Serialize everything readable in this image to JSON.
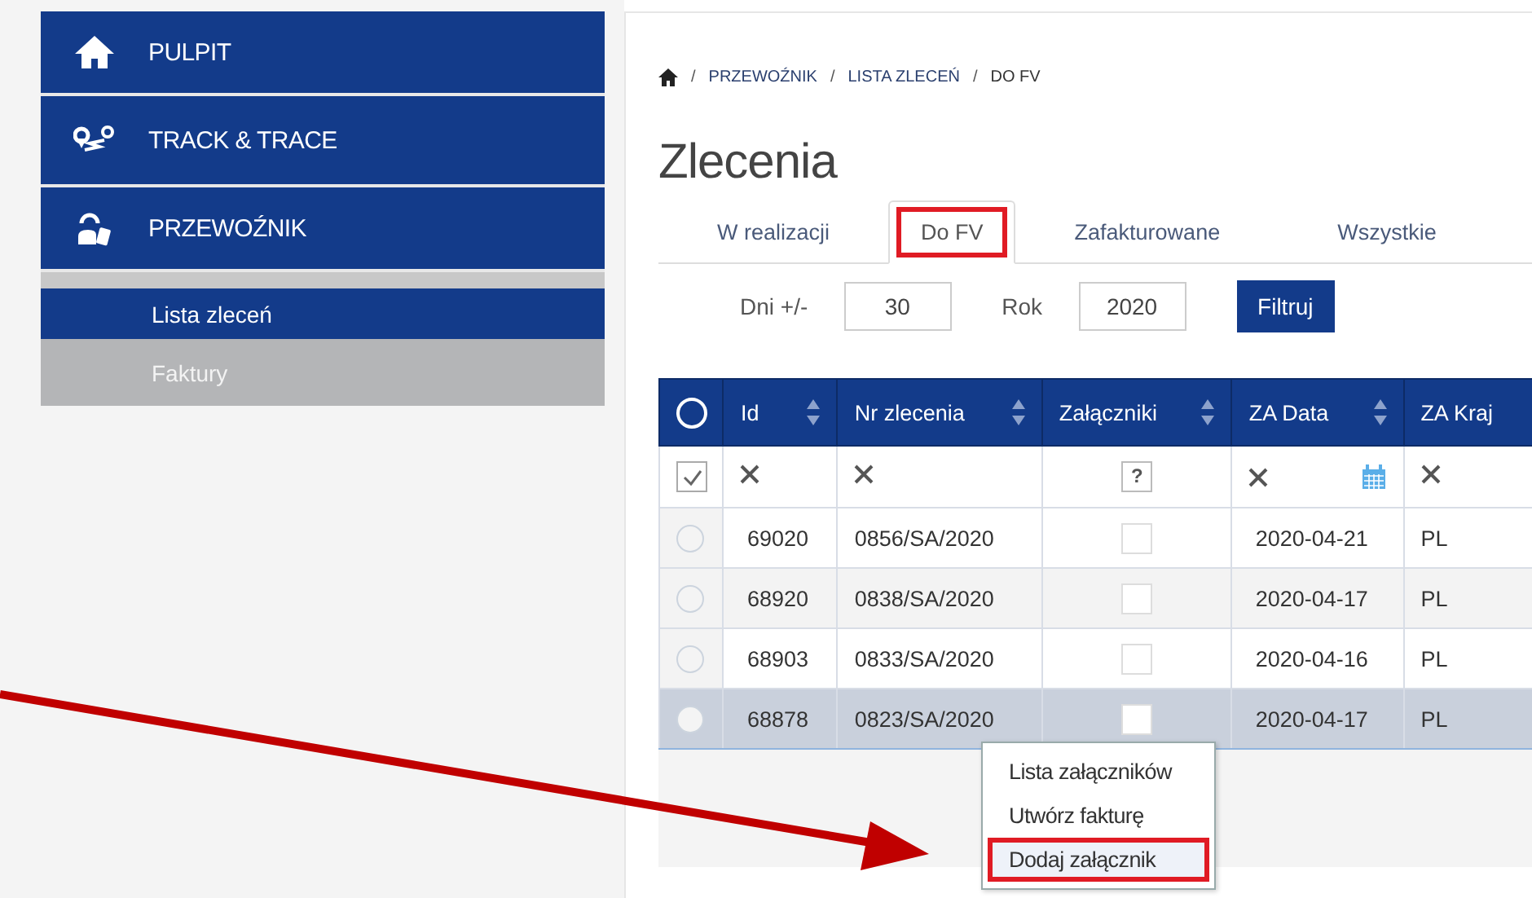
{
  "sidebar": {
    "items": [
      {
        "label": "PULPIT",
        "expanded": false
      },
      {
        "label": "TRACK & TRACE",
        "expanded": false
      },
      {
        "label": "PRZEWOŹNIK",
        "expanded": true,
        "children": [
          {
            "label": "Lista zleceń",
            "selected": true
          },
          {
            "label": "Faktury",
            "selected": false
          }
        ]
      }
    ]
  },
  "breadcrumb": {
    "separator": "/",
    "items": [
      "PRZEWOŹNIK",
      "LISTA ZLECEŃ",
      "DO FV"
    ]
  },
  "title": "Zlecenia",
  "tabs": [
    {
      "label": "W realizacji",
      "selected": false,
      "highlighted": false
    },
    {
      "label": "Do FV",
      "selected": true,
      "highlighted": true
    },
    {
      "label": "Zafakturowane",
      "selected": false,
      "highlighted": false
    },
    {
      "label": "Wszystkie",
      "selected": false,
      "highlighted": false
    }
  ],
  "filters": {
    "days_label": "Dni +/-",
    "days": "30",
    "year_label": "Rok",
    "year": "2020",
    "button": "Filtruj"
  },
  "table": {
    "columns": [
      "Id",
      "Nr zlecenia",
      "Załączniki",
      "ZA Data",
      "ZA Kraj"
    ],
    "all_selected": false,
    "filter_row": {
      "checked": true,
      "attachment_filter": "?"
    },
    "rows": [
      {
        "id": "69020",
        "number": "0856/SA/2020",
        "attachment": false,
        "date": "2020-04-21",
        "country": "PL",
        "selected": false
      },
      {
        "id": "68920",
        "number": "0838/SA/2020",
        "attachment": false,
        "date": "2020-04-17",
        "country": "PL",
        "selected": false
      },
      {
        "id": "68903",
        "number": "0833/SA/2020",
        "attachment": false,
        "date": "2020-04-16",
        "country": "PL",
        "selected": false
      },
      {
        "id": "68878",
        "number": "0823/SA/2020",
        "attachment": false,
        "date": "2020-04-17",
        "country": "PL",
        "selected": true
      }
    ]
  },
  "context_menu": {
    "items": [
      {
        "label": "Lista załączników",
        "highlighted": false
      },
      {
        "label": "Utwórz fakturę",
        "highlighted": false
      },
      {
        "label": "Dodaj załącznik",
        "highlighted": true
      }
    ]
  }
}
